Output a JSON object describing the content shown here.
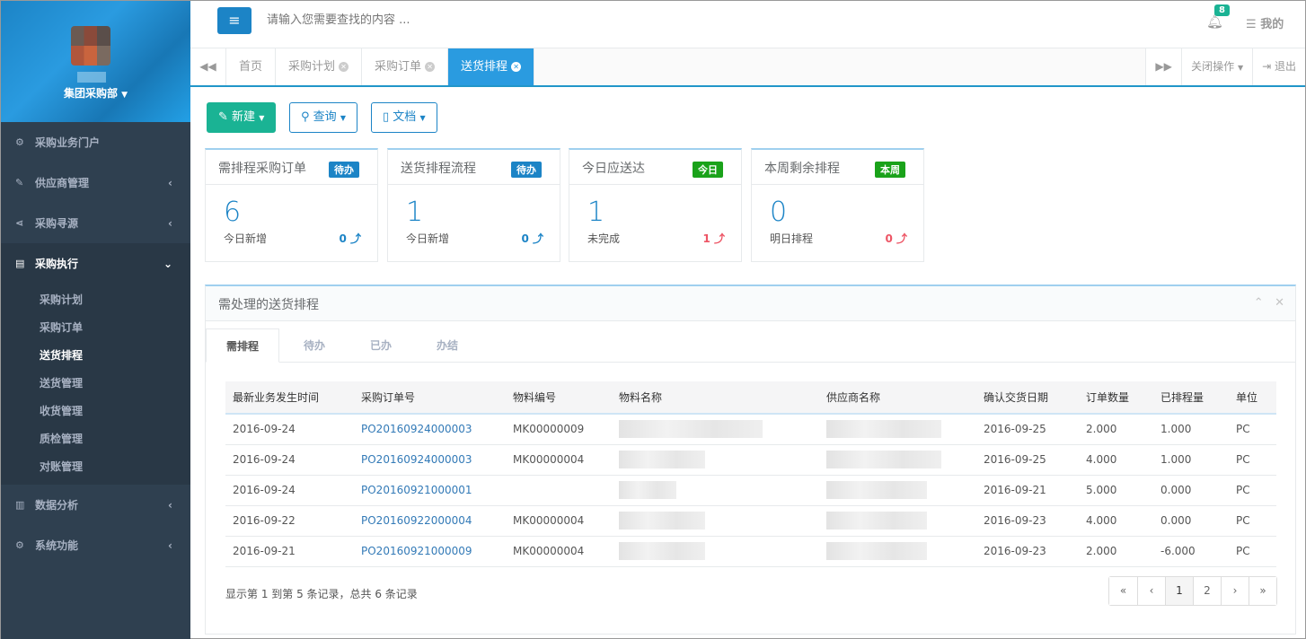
{
  "sidebar": {
    "department": "集团采购部",
    "nav": [
      {
        "label": "采购业务门户",
        "icon": "cubes-icon"
      },
      {
        "label": "供应商管理",
        "icon": "wrench-icon"
      },
      {
        "label": "采购寻源",
        "icon": "share-icon"
      },
      {
        "label": "采购执行",
        "icon": "list-icon"
      },
      {
        "label": "数据分析",
        "icon": "bar-chart-icon"
      },
      {
        "label": "系统功能",
        "icon": "cogs-icon"
      }
    ],
    "submenu": [
      "采购计划",
      "采购订单",
      "送货排程",
      "送货管理",
      "收货管理",
      "质检管理",
      "对账管理"
    ]
  },
  "topbar": {
    "search_placeholder": "请输入您需要查找的内容 ...",
    "notification_count": "8",
    "mine_label": "我的"
  },
  "tabs": {
    "items": [
      {
        "label": "首页"
      },
      {
        "label": "采购计划"
      },
      {
        "label": "采购订单"
      },
      {
        "label": "送货排程"
      }
    ],
    "close_ops": "关闭操作",
    "logout": "退出"
  },
  "toolbar": {
    "new_label": "新建",
    "query_label": "查询",
    "doc_label": "文档"
  },
  "stats": [
    {
      "title": "需排程采购订单",
      "badge": "待办",
      "badge_color": "#1c84c6",
      "value": "6",
      "sub": "今日新增",
      "delta": "0",
      "delta_color": "#1c84c6"
    },
    {
      "title": "送货排程流程",
      "badge": "待办",
      "badge_color": "#1c84c6",
      "value": "1",
      "sub": "今日新增",
      "delta": "0",
      "delta_color": "#1c84c6"
    },
    {
      "title": "今日应送达",
      "badge": "今日",
      "badge_color": "#1aa21a",
      "value": "1",
      "sub": "未完成",
      "delta": "1",
      "delta_color": "#ed5565"
    },
    {
      "title": "本周剩余排程",
      "badge": "本周",
      "badge_color": "#1aa21a",
      "value": "0",
      "sub": "明日排程",
      "delta": "0",
      "delta_color": "#ed5565"
    }
  ],
  "panel": {
    "title": "需处理的送货排程",
    "tabs": [
      "需排程",
      "待办",
      "已办",
      "办结"
    ],
    "columns": [
      "最新业务发生时间",
      "采购订单号",
      "物料编号",
      "物料名称",
      "供应商名称",
      "确认交货日期",
      "订单数量",
      "已排程量",
      "单位"
    ],
    "rows": [
      {
        "time": "2016-09-24",
        "po": "PO20160924000003",
        "material": "MK00000009",
        "date": "2016-09-25",
        "qty": "2.000",
        "scheduled": "1.000",
        "unit": "PC"
      },
      {
        "time": "2016-09-24",
        "po": "PO20160924000003",
        "material": "MK00000004",
        "date": "2016-09-25",
        "qty": "4.000",
        "scheduled": "1.000",
        "unit": "PC"
      },
      {
        "time": "2016-09-24",
        "po": "PO20160921000001",
        "material": "",
        "date": "2016-09-21",
        "qty": "5.000",
        "scheduled": "0.000",
        "unit": "PC"
      },
      {
        "time": "2016-09-22",
        "po": "PO20160922000004",
        "material": "MK00000004",
        "date": "2016-09-23",
        "qty": "4.000",
        "scheduled": "0.000",
        "unit": "PC"
      },
      {
        "time": "2016-09-21",
        "po": "PO20160921000009",
        "material": "MK00000004",
        "date": "2016-09-23",
        "qty": "2.000",
        "scheduled": "-6.000",
        "unit": "PC"
      }
    ],
    "page_info": "显示第 1 到第 5 条记录，总共 6 条记录",
    "pager": [
      "«",
      "‹",
      "1",
      "2",
      "›",
      "»"
    ]
  }
}
